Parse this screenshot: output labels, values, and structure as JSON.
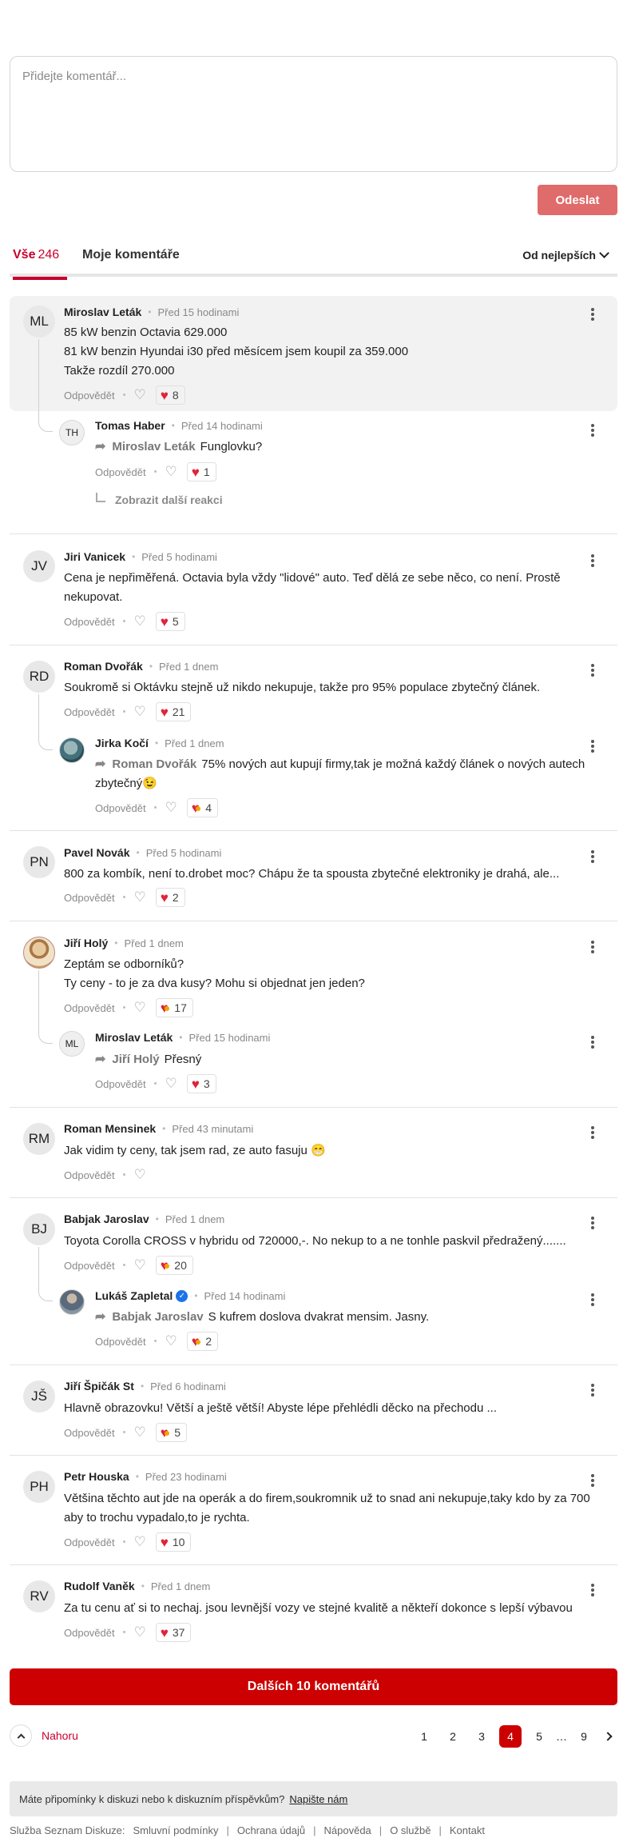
{
  "composer": {
    "placeholder": "Přidejte komentář...",
    "send_label": "Odeslat"
  },
  "tabs": {
    "all_label": "Vše",
    "all_count": "246",
    "mine_label": "Moje komentáře",
    "sort_label": "Od nejlepších"
  },
  "comments": [
    {
      "initials": "ML",
      "name": "Miroslav Leták",
      "time": "Před 15 hodinami",
      "lines": [
        "85 kW benzin Octavia 629.000",
        "81 kW benzin Hyundai i30 před měsícem jsem koupil za 359.000",
        "Takže rozdíl 270.000"
      ],
      "reply_label": "Odpovědět",
      "reactions": "8"
    },
    {
      "initials": "TH",
      "name": "Tomas Haber",
      "time": "Před 14 hodinami",
      "reply_to": "Miroslav Leták",
      "text": "Funglovku?",
      "reply_label": "Odpovědět",
      "reactions": "1",
      "more_replies": "Zobrazit další reakci"
    },
    {
      "initials": "JV",
      "name": "Jiri Vanicek",
      "time": "Před 5 hodinami",
      "lines": [
        "Cena je nepřiměřená. Octavia byla vždy \"lidové\" auto. Teď dělá ze sebe něco, co není. Prostě",
        "nekupovat."
      ],
      "reply_label": "Odpovědět",
      "reactions": "5"
    },
    {
      "initials": "RD",
      "name": "Roman Dvořák",
      "time": "Před 1 dnem",
      "text": "Soukromě si Oktávku stejně už nikdo nekupuje, takže pro 95% populace zbytečný článek.",
      "reply_label": "Odpovědět",
      "reactions": "21"
    },
    {
      "name": "Jirka Kočí",
      "time": "Před 1 dnem",
      "reply_to": "Roman Dvořák",
      "lines": [
        "75% nových aut kupují firmy,tak je možná každý článek o nových autech",
        "zbytečný😉"
      ],
      "reply_label": "Odpovědět",
      "reactions": "4"
    },
    {
      "initials": "PN",
      "name": "Pavel Novák",
      "time": "Před 5 hodinami",
      "text": "800 za kombík, není to.drobet moc? Chápu že ta spousta zbytečné elektroniky je drahá, ale...",
      "reply_label": "Odpovědět",
      "reactions": "2"
    },
    {
      "name": "Jiří Holý",
      "time": "Před 1 dnem",
      "lines": [
        "Zeptám se odborníků?",
        "Ty ceny - to je za dva kusy? Mohu si objednat jen jeden?"
      ],
      "reply_label": "Odpovědět",
      "reactions": "17"
    },
    {
      "initials": "ML",
      "name": "Miroslav Leták",
      "time": "Před 15 hodinami",
      "reply_to": "Jiří Holý",
      "text": "Přesný",
      "reply_label": "Odpovědět",
      "reactions": "3"
    },
    {
      "initials": "RM",
      "name": "Roman Mensinek",
      "time": "Před 43 minutami",
      "text": "Jak vidim ty ceny, tak jsem rad, ze auto fasuju 😁",
      "reply_label": "Odpovědět"
    },
    {
      "initials": "BJ",
      "name": "Babjak Jaroslav",
      "time": "Před 1 dnem",
      "text": "Toyota Corolla CROSS v hybridu od 720000,-. No nekup to a ne tonhle paskvil předražený.......",
      "reply_label": "Odpovědět",
      "reactions": "20"
    },
    {
      "name": "Lukáš Zapletal",
      "time": "Před 14 hodinami",
      "reply_to": "Babjak Jaroslav",
      "text": "S kufrem doslova dvakrat mensim. Jasny.",
      "reply_label": "Odpovědět",
      "reactions": "2"
    },
    {
      "initials": "JŠ",
      "name": "Jiří Špičák St",
      "time": "Před 6 hodinami",
      "text": "Hlavně obrazovku! Větší a ještě větší! Abyste lépe přehlédli děcko na přechodu ...",
      "reply_label": "Odpovědět",
      "reactions": "5"
    },
    {
      "initials": "PH",
      "name": "Petr Houska",
      "time": "Před 23 hodinami",
      "lines": [
        "Většina těchto aut jde na operák a do firem,soukromnik už to snad ani nekupuje,taky kdo by za 700",
        "aby to trochu vypadalo,to je rychta."
      ],
      "reply_label": "Odpovědět",
      "reactions": "10"
    },
    {
      "initials": "RV",
      "name": "Rudolf Vaněk",
      "time": "Před 1 dnem",
      "text": "Za tu cenu ať si to nechaj. jsou levnější vozy ve stejné kvalitě a někteří dokonce s lepší výbavou",
      "reply_label": "Odpovědět",
      "reactions": "37"
    }
  ],
  "load_more_label": "Dalších 10 komentářů",
  "pagination": {
    "up_label": "Nahoru",
    "pages": [
      "1",
      "2",
      "3",
      "4",
      "5",
      "…",
      "9"
    ],
    "current": "4"
  },
  "feedback": {
    "text": "Máte připomínky k diskuzi nebo k diskuzním příspěvkům?",
    "link": "Napište nám"
  },
  "footer": {
    "label": "Služba Seznam Diskuze:",
    "links": [
      "Smluvní podmínky",
      "Ochrana údajů",
      "Nápověda",
      "O službě",
      "Kontakt"
    ]
  },
  "colors": {
    "accent": "#cc0000",
    "send_button": "#e06b6b",
    "heart": "#e0243b"
  }
}
